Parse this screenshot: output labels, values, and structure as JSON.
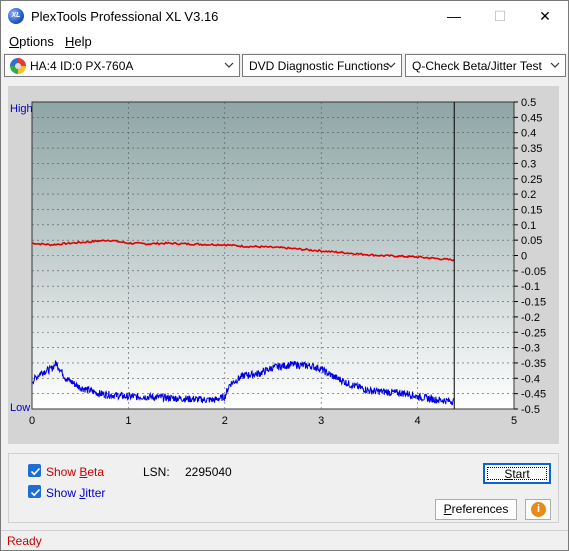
{
  "window": {
    "title": "PlexTools Professional XL V3.16",
    "app_icon_text": "XL",
    "minimize": "—",
    "maximize": "☐",
    "close": "✕"
  },
  "menu": {
    "options_accel": "O",
    "options_rest": "ptions",
    "help_accel": "H",
    "help_rest": "elp"
  },
  "toolbar": {
    "drive": "HA:4 ID:0  PX-760A",
    "function": "DVD Diagnostic Functions",
    "test": "Q-Check Beta/Jitter Test"
  },
  "chart": {
    "y_left_high": "High",
    "y_left_low": "Low",
    "x_ticks": [
      "0",
      "1",
      "2",
      "3",
      "4",
      "5"
    ],
    "y_ticks": [
      "0.5",
      "0.45",
      "0.4",
      "0.35",
      "0.3",
      "0.25",
      "0.2",
      "0.15",
      "0.1",
      "0.05",
      "0",
      "-0.05",
      "-0.1",
      "-0.15",
      "-0.2",
      "-0.25",
      "-0.3",
      "-0.35",
      "-0.4",
      "-0.45",
      "-0.5"
    ]
  },
  "chart_data": {
    "type": "line",
    "xlim": [
      0,
      5
    ],
    "ylim": [
      -0.5,
      0.5
    ],
    "x_ticks": [
      "0",
      "1",
      "2",
      "3",
      "4",
      "5"
    ],
    "y_ticks_right": [
      "0.5",
      "0.45",
      "0.4",
      "0.35",
      "0.3",
      "0.25",
      "0.2",
      "0.15",
      "0.1",
      "0.05",
      "0",
      "-0.05",
      "-0.1",
      "-0.15",
      "-0.2",
      "-0.25",
      "-0.3",
      "-0.35",
      "-0.4",
      "-0.45",
      "-0.5"
    ],
    "y_left_labels": [
      "High",
      "Low"
    ],
    "grid": true,
    "end_marker_x": 4.38,
    "series": [
      {
        "color": "#e00000",
        "x": [
          0,
          0.2,
          0.4,
          0.6,
          0.8,
          1.0,
          1.2,
          1.4,
          1.6,
          1.8,
          2.0,
          2.2,
          2.4,
          2.6,
          2.8,
          3.0,
          3.2,
          3.4,
          3.6,
          3.8,
          4.0,
          4.2,
          4.38
        ],
        "values": [
          0.04,
          0.035,
          0.04,
          0.045,
          0.05,
          0.04,
          0.038,
          0.04,
          0.038,
          0.036,
          0.035,
          0.03,
          0.028,
          0.025,
          0.02,
          0.015,
          0.01,
          0.005,
          0.0,
          -0.002,
          -0.005,
          -0.01,
          -0.015
        ]
      },
      {
        "color": "#0000e0",
        "x": [
          0,
          0.1,
          0.2,
          0.25,
          0.35,
          0.5,
          0.7,
          1.0,
          1.2,
          1.5,
          1.8,
          1.9,
          2.0,
          2.05,
          2.2,
          2.35,
          2.5,
          2.7,
          2.9,
          3.0,
          3.1,
          3.3,
          3.5,
          3.7,
          3.9,
          4.0,
          4.2,
          4.38
        ],
        "values": [
          -0.41,
          -0.38,
          -0.37,
          -0.35,
          -0.4,
          -0.43,
          -0.45,
          -0.46,
          -0.46,
          -0.465,
          -0.47,
          -0.47,
          -0.46,
          -0.42,
          -0.39,
          -0.385,
          -0.365,
          -0.355,
          -0.36,
          -0.37,
          -0.39,
          -0.42,
          -0.44,
          -0.445,
          -0.45,
          -0.46,
          -0.47,
          -0.475
        ]
      }
    ]
  },
  "controls": {
    "show_beta_accel_pre": "Show ",
    "show_beta_accel": "B",
    "show_beta_rest": "eta",
    "show_jitter_pre": "Show ",
    "show_jitter_accel": "J",
    "show_jitter_rest": "itter",
    "lsn_label": "LSN:",
    "lsn_value": "2295040",
    "start_accel": "S",
    "start_rest": "tart",
    "prefs_accel_pre": "P",
    "prefs_rest": "references",
    "info_icon_text": "i"
  },
  "status": {
    "text": "Ready"
  }
}
